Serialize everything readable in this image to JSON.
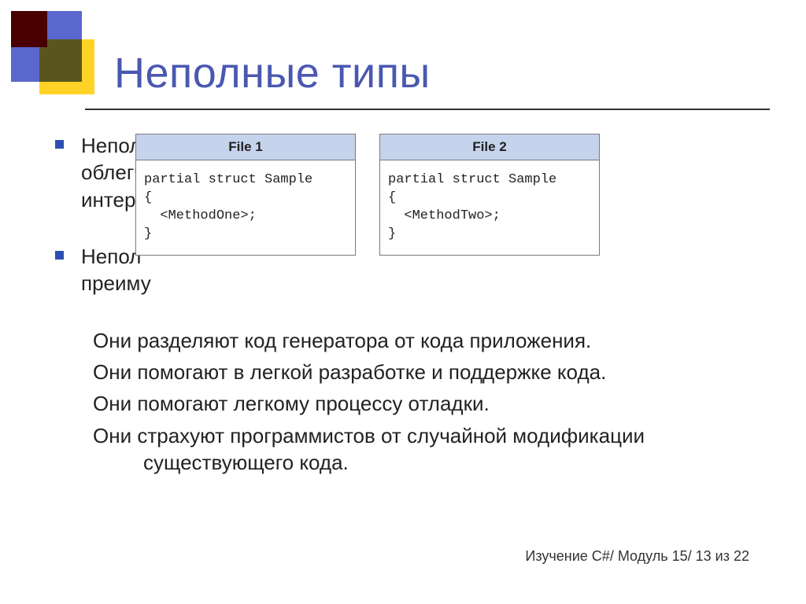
{
  "title": "Неполные типы",
  "bullets": [
    {
      "prefix": "Непол",
      "rest_lines": [
        "облегч",
        "интерф"
      ]
    },
    {
      "prefix": "Непол",
      "rest_lines": [
        "преиму"
      ]
    }
  ],
  "subs": [
    "Они разделяют код генератора от кода приложения.",
    "Они помогают в легкой разработке и поддержке кода.",
    "Они помогают легкому процессу отладки.",
    "Они страхуют программистов от случайной модификации существующего кода."
  ],
  "code_boxes": [
    {
      "header": "File 1",
      "code": "partial struct Sample\n{\n  <MethodOne>;\n}"
    },
    {
      "header": "File 2",
      "code": "partial struct Sample\n{\n  <MethodTwo>;\n}"
    }
  ],
  "footer": "Изучение C#/ Модуль 15/ 13 из 22"
}
